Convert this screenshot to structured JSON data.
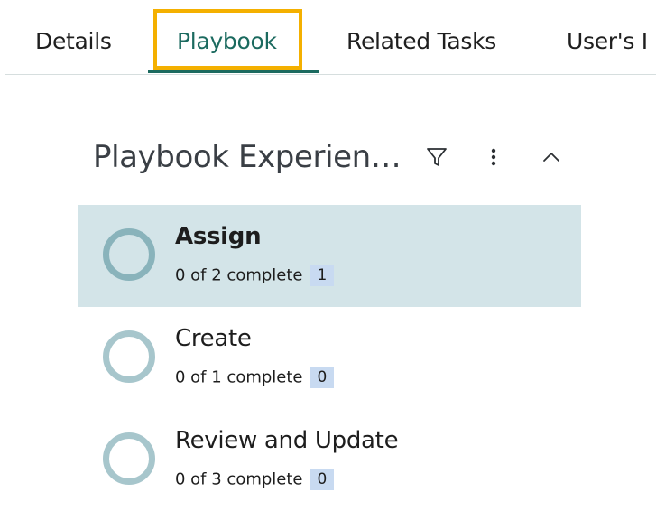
{
  "tabs": [
    {
      "label": "Details",
      "active": false
    },
    {
      "label": "Playbook",
      "active": true
    },
    {
      "label": "Related Tasks",
      "active": false
    },
    {
      "label": "User's I",
      "active": false
    }
  ],
  "section": {
    "title": "Playbook Experien…",
    "icons": [
      "filter-icon",
      "more-vertical-icon",
      "chevron-up-icon"
    ]
  },
  "stages": [
    {
      "name": "Assign",
      "progress": "0 of 2 complete",
      "count": "1",
      "selected": true
    },
    {
      "name": "Create",
      "progress": "0 of 1 complete",
      "count": "0",
      "selected": false
    },
    {
      "name": "Review and Update",
      "progress": "0 of 3 complete",
      "count": "0",
      "selected": false
    }
  ],
  "colors": {
    "accent": "#1b6a5f",
    "highlight_box": "#f4b000",
    "selected_row": "#d3e4e8",
    "badge": "#c8daf1",
    "ring": "#a7c6cc"
  }
}
